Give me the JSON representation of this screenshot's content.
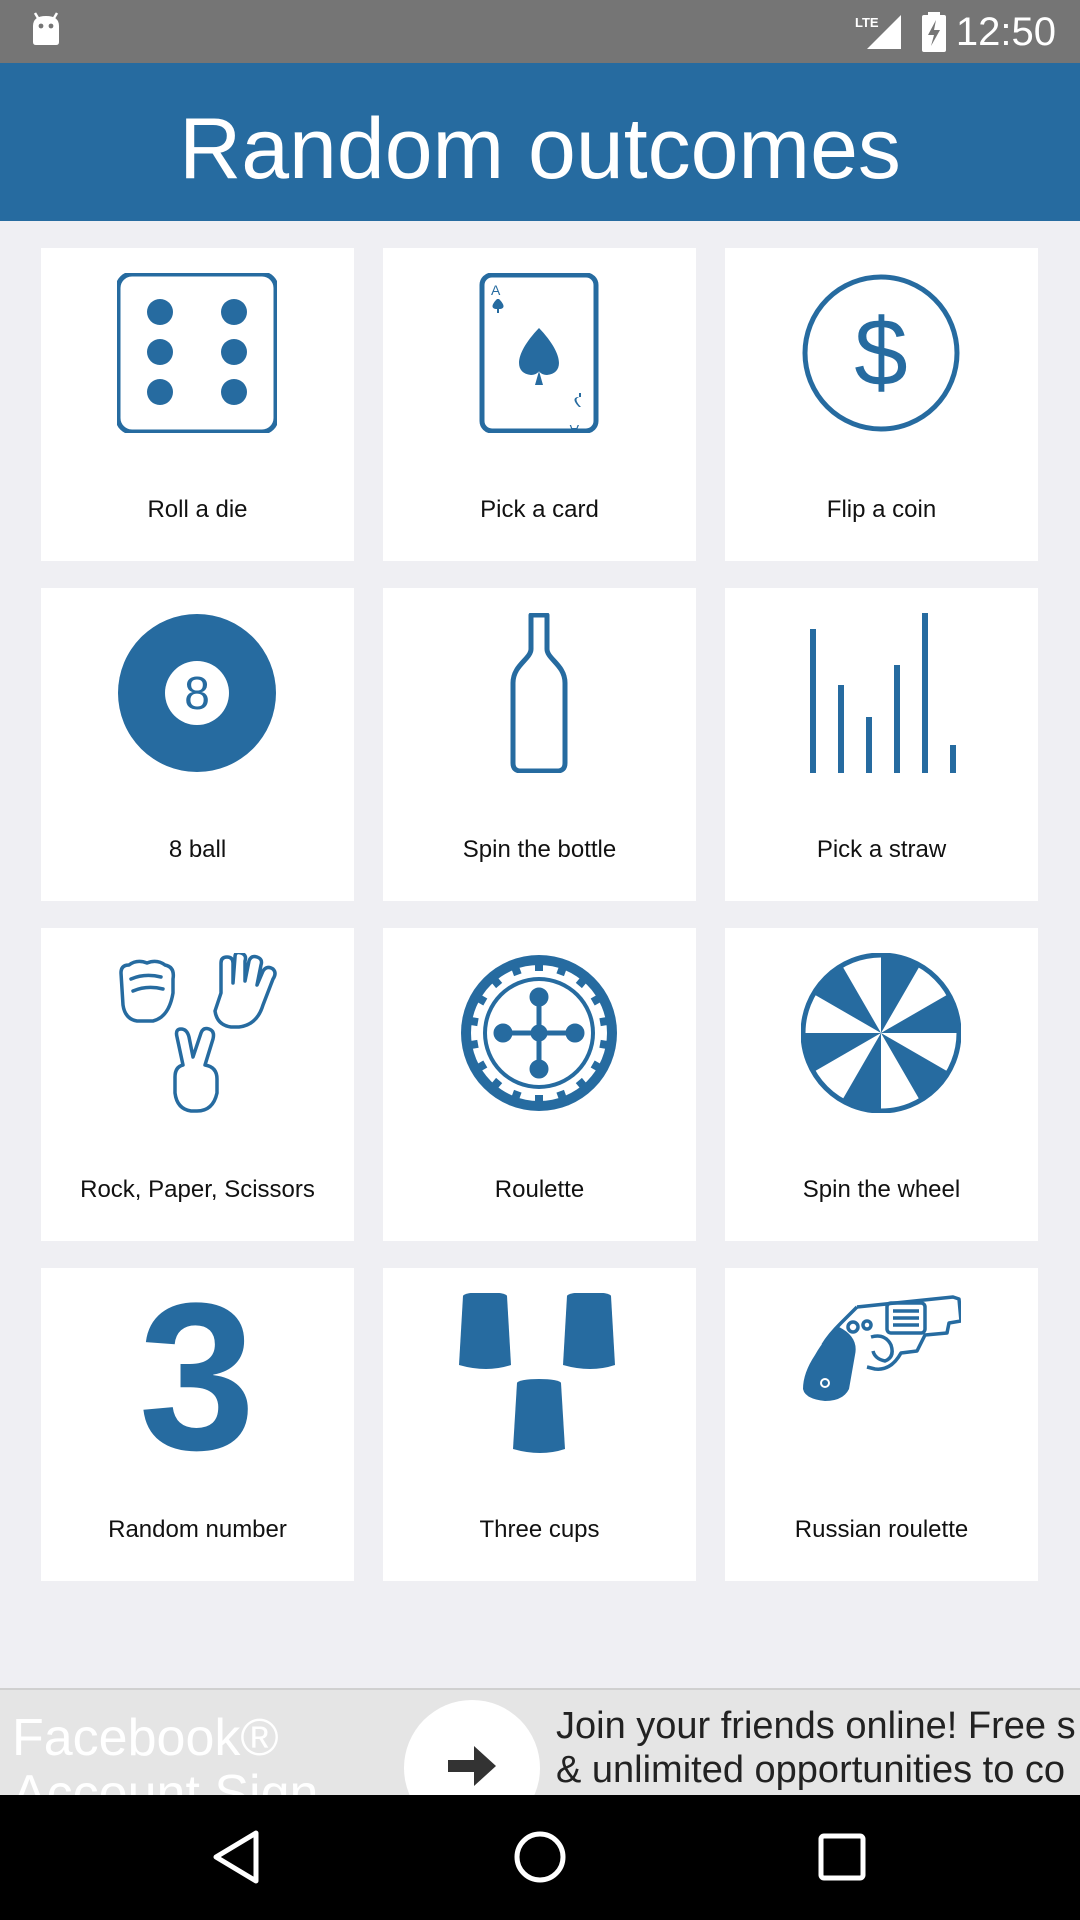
{
  "status_bar": {
    "time": "12:50",
    "network": "LTE",
    "icons": [
      "android-icon",
      "lte-signal-icon",
      "battery-charging-icon"
    ]
  },
  "app_bar": {
    "title": "Random outcomes"
  },
  "grid": {
    "items": [
      {
        "label": "Roll a die",
        "icon": "die-icon"
      },
      {
        "label": "Pick a card",
        "icon": "playing-card-icon"
      },
      {
        "label": "Flip a coin",
        "icon": "coin-icon"
      },
      {
        "label": "8 ball",
        "icon": "eight-ball-icon",
        "icon_text": "8"
      },
      {
        "label": "Spin the bottle",
        "icon": "bottle-icon"
      },
      {
        "label": "Pick a straw",
        "icon": "straws-icon"
      },
      {
        "label": "Rock, Paper, Scissors",
        "icon": "rock-paper-scissors-icon"
      },
      {
        "label": "Roulette",
        "icon": "roulette-icon"
      },
      {
        "label": "Spin the wheel",
        "icon": "wheel-icon"
      },
      {
        "label": "Random number",
        "icon": "random-number-icon",
        "icon_text": "3"
      },
      {
        "label": "Three cups",
        "icon": "three-cups-icon"
      },
      {
        "label": "Russian roulette",
        "icon": "revolver-icon"
      }
    ]
  },
  "ad_banner": {
    "title": "Facebook® Account Sign Up",
    "text_line1": "Join your friends online! Free s",
    "text_line2": "& unlimited opportunities to co",
    "icon": "arrow-right-icon"
  },
  "nav_bar": {
    "buttons": [
      "back-icon",
      "home-icon",
      "recents-icon"
    ]
  },
  "colors": {
    "primary": "#266ba0",
    "status_bar": "#757575",
    "background": "#efeff3",
    "tile": "#ffffff"
  }
}
